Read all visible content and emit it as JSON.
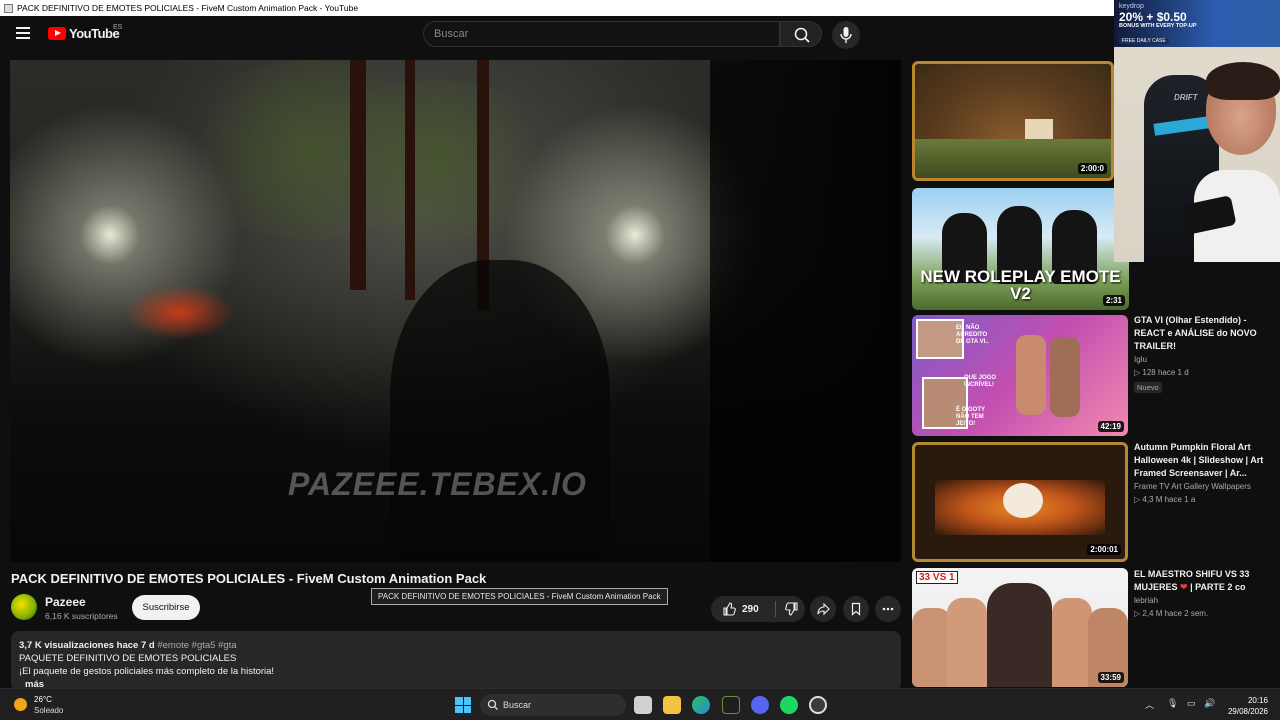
{
  "window": {
    "title": "PACK DEFINITIVO DE EMOTES POLICIALES - FiveM Custom Animation Pack - YouTube"
  },
  "header": {
    "logo_text": "YouTube",
    "region": "ES",
    "search_placeholder": "Buscar"
  },
  "player": {
    "watermark": "PAZEEE.TEBEX.IO"
  },
  "video": {
    "title": "PACK DEFINITIVO DE EMOTES POLICIALES - FiveM Custom Animation Pack",
    "tooltip": "PACK DEFINITIVO DE EMOTES POLICIALES - FiveM Custom Animation Pack",
    "channel": "Pazeee",
    "subscribers": "6,16 K suscriptores",
    "subscribe_label": "Suscribirse",
    "likes": "290"
  },
  "description": {
    "stats": "3,7 K visualizaciones  hace 7 d",
    "tags": "#emote #gta5 #gta",
    "line1": "PAQUETE DEFINITIVO DE EMOTES POLICIALES",
    "line2": "¡El paquete de gestos policiales más completo de la historia!",
    "more": "más"
  },
  "recommendations": [
    {
      "duration": "2:00:0",
      "title": "",
      "channel": "",
      "meta": ""
    },
    {
      "duration": "2:31",
      "thumb_text": "NEW ROLEPLAY EMOTE V2",
      "title": "",
      "channel": "",
      "meta": ""
    },
    {
      "duration": "42:19",
      "thumb_text_1": "EU NÃO ACREDITO DE GTA VI..",
      "thumb_text_2": "QUE JOGO INCRÍVEL!",
      "thumb_text_3": "É O GOTY NÃO TEM JEITO!",
      "title": "GTA VI (Olhar Estendido) - REACT e ANÁLISE do NOVO TRAILER!",
      "channel": "Iglu",
      "meta": "▷ 128  hace 1 d",
      "badge": "Nuevo"
    },
    {
      "duration": "2:00:01",
      "title": "Autumn Pumpkin Floral Art Halloween 4k | Slideshow | Art Framed Screensaver | Ar...",
      "channel": "Frame TV Art Gallery Wallpapers",
      "meta": "▷ 4,3 M  hace 1 a"
    },
    {
      "duration": "33:59",
      "thumb_text": "33 VS 1",
      "title": "EL MAESTRO SHIFU VS 33 MUJERES",
      "title_suffix": " | PARTE 2 co",
      "channel": "lebriah",
      "meta": "▷ 2,4 M  hace 2 sem."
    }
  ],
  "ad": {
    "brand": "keydrop",
    "offer": "20% + $0.50",
    "sub": "BONUS WITH EVERY TOP-UP",
    "pill": "FREE DAILY CASE"
  },
  "webcam": {
    "chair_brand": "DRIFT"
  },
  "taskbar": {
    "temperature": "26°C",
    "condition": "Soleado",
    "search_label": "Buscar",
    "time": "20:16",
    "date": "29/08/2026"
  },
  "colors": {
    "background": "#0f0f0f",
    "accent_red": "#ff0000",
    "surface": "#272727"
  }
}
